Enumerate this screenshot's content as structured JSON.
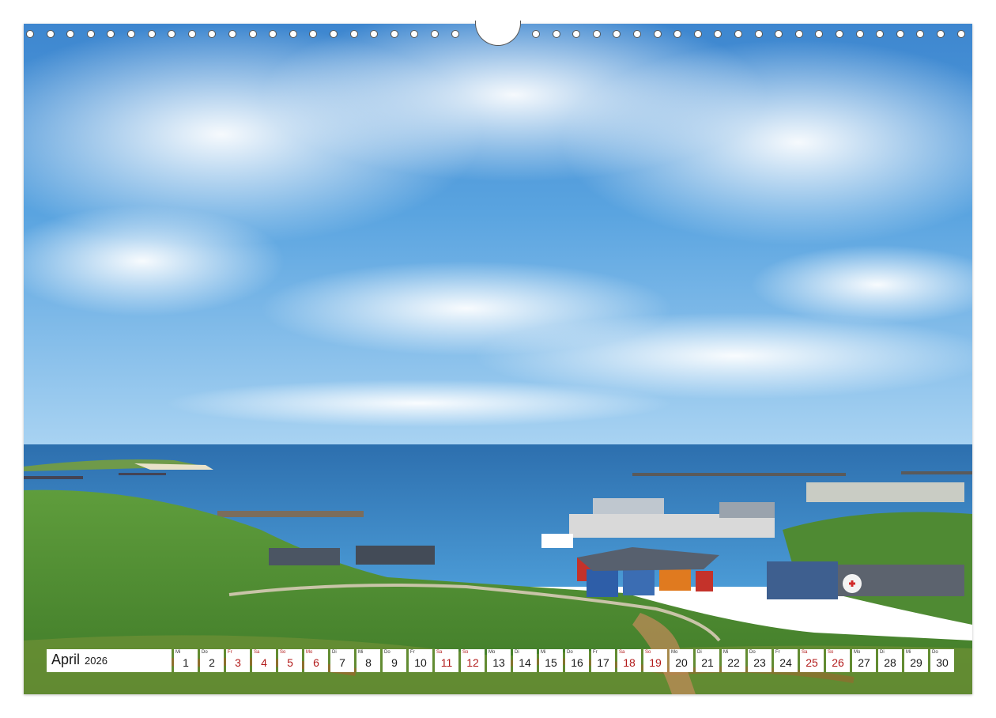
{
  "calendar": {
    "month": "April",
    "year": "2026",
    "weekend_color": "#b21a1a",
    "days": [
      {
        "dow": "Mi",
        "num": "1",
        "weekend": false
      },
      {
        "dow": "Do",
        "num": "2",
        "weekend": false
      },
      {
        "dow": "Fr",
        "num": "3",
        "weekend": true
      },
      {
        "dow": "Sa",
        "num": "4",
        "weekend": true
      },
      {
        "dow": "So",
        "num": "5",
        "weekend": true
      },
      {
        "dow": "Mo",
        "num": "6",
        "weekend": true
      },
      {
        "dow": "Di",
        "num": "7",
        "weekend": false
      },
      {
        "dow": "Mi",
        "num": "8",
        "weekend": false
      },
      {
        "dow": "Do",
        "num": "9",
        "weekend": false
      },
      {
        "dow": "Fr",
        "num": "10",
        "weekend": false
      },
      {
        "dow": "Sa",
        "num": "11",
        "weekend": true
      },
      {
        "dow": "So",
        "num": "12",
        "weekend": true
      },
      {
        "dow": "Mo",
        "num": "13",
        "weekend": false
      },
      {
        "dow": "Di",
        "num": "14",
        "weekend": false
      },
      {
        "dow": "Mi",
        "num": "15",
        "weekend": false
      },
      {
        "dow": "Do",
        "num": "16",
        "weekend": false
      },
      {
        "dow": "Fr",
        "num": "17",
        "weekend": false
      },
      {
        "dow": "Sa",
        "num": "18",
        "weekend": true
      },
      {
        "dow": "So",
        "num": "19",
        "weekend": true
      },
      {
        "dow": "Mo",
        "num": "20",
        "weekend": false
      },
      {
        "dow": "Di",
        "num": "21",
        "weekend": false
      },
      {
        "dow": "Mi",
        "num": "22",
        "weekend": false
      },
      {
        "dow": "Do",
        "num": "23",
        "weekend": false
      },
      {
        "dow": "Fr",
        "num": "24",
        "weekend": false
      },
      {
        "dow": "Sa",
        "num": "25",
        "weekend": true
      },
      {
        "dow": "So",
        "num": "26",
        "weekend": true
      },
      {
        "dow": "Mo",
        "num": "27",
        "weekend": false
      },
      {
        "dow": "Di",
        "num": "28",
        "weekend": false
      },
      {
        "dow": "Mi",
        "num": "29",
        "weekend": false
      },
      {
        "dow": "Do",
        "num": "30",
        "weekend": false
      }
    ]
  }
}
